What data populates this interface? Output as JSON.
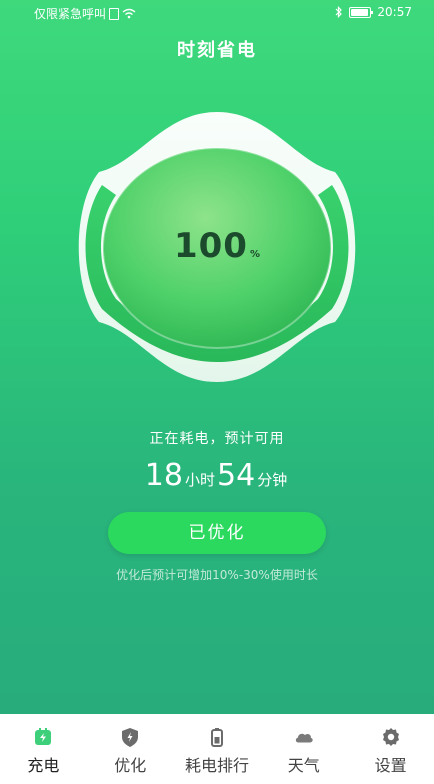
{
  "status_bar": {
    "carrier_text": "仅限紧急呼叫",
    "time": "20:57",
    "icons": [
      "sim-icon",
      "wifi-icon",
      "bluetooth-icon",
      "battery-icon"
    ]
  },
  "header": {
    "title": "时刻省电"
  },
  "gauge": {
    "value": 100,
    "unit": "%",
    "value_text": "100"
  },
  "main": {
    "status_text": "正在耗电，预计可用",
    "hours": "18",
    "hours_unit": "小时",
    "minutes": "54",
    "minutes_unit": "分钟",
    "button_label": "已优化",
    "hint": "优化后预计可增加10%-30%使用时长"
  },
  "nav": {
    "items": [
      {
        "label": "充电",
        "icon": "charge-icon",
        "active": true
      },
      {
        "label": "优化",
        "icon": "shield-icon",
        "active": false
      },
      {
        "label": "耗电排行",
        "icon": "battery-rank-icon",
        "active": false
      },
      {
        "label": "天气",
        "icon": "cloud-icon",
        "active": false
      },
      {
        "label": "设置",
        "icon": "gear-icon",
        "active": false
      }
    ]
  },
  "colors": {
    "accent": "#2bd95e",
    "active_icon": "#3ecf7a",
    "inactive_icon": "#6b6b6b",
    "percent_text": "#1c4a2c"
  }
}
